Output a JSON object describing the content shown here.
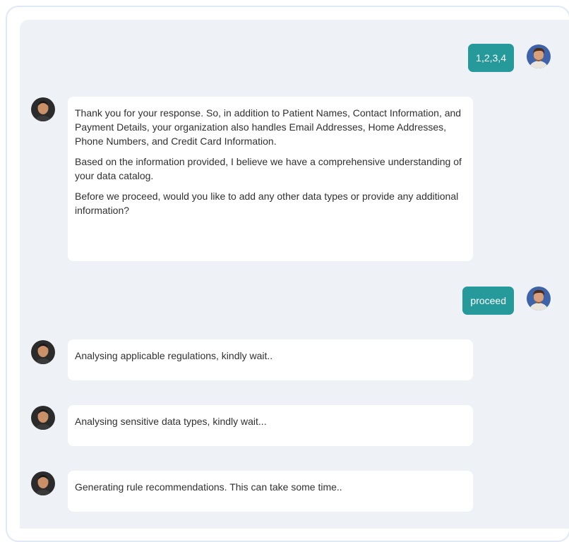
{
  "messages": [
    {
      "role": "user",
      "text": "1,2,3,4"
    },
    {
      "role": "bot",
      "paragraphs": [
        "Thank you for your response. So, in addition to Patient Names, Contact Information, and Payment Details, your organization also handles Email Addresses, Home Addresses, Phone Numbers, and Credit Card Information.",
        "Based on the information provided, I believe we have a comprehensive understanding of your data catalog.",
        "Before we proceed, would you like to add any other data types or provide any additional information?"
      ]
    },
    {
      "role": "user",
      "text": "proceed"
    },
    {
      "role": "bot",
      "paragraphs": [
        "Analysing applicable regulations, kindly wait.."
      ]
    },
    {
      "role": "bot",
      "paragraphs": [
        "Analysing sensitive data types, kindly wait..."
      ]
    },
    {
      "role": "bot",
      "paragraphs": [
        "Generating rule recommendations. This can take some time.."
      ]
    }
  ],
  "icons": {
    "user_avatar": "user-avatar-icon",
    "bot_avatar": "bot-avatar-icon"
  },
  "colors": {
    "user_bubble": "#26999b",
    "chat_background": "#eef2f6",
    "bot_bubble": "#ffffff"
  }
}
